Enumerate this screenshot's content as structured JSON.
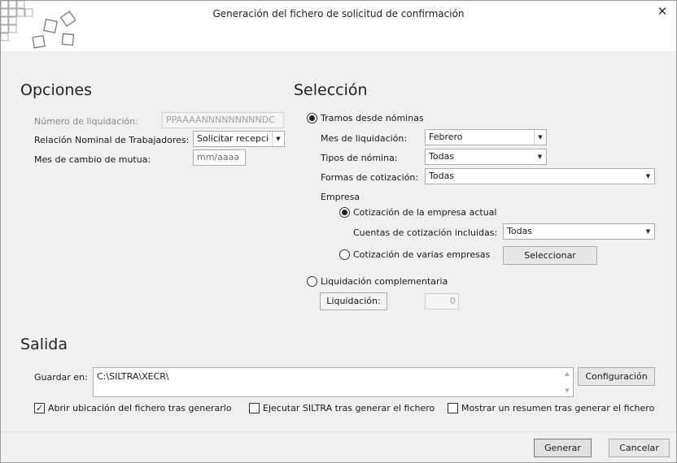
{
  "window": {
    "title": "Generación del fichero de solicitud de confirmación",
    "close_glyph": "✕"
  },
  "opciones": {
    "title": "Opciones",
    "numero_label": "Número de liquidación:",
    "numero_value": "PPAAAANNNNNNNNNDC",
    "relacion_label": "Relación Nominal de Trabajadores:",
    "relacion_value": "Solicitar recepció",
    "mes_cambio_label": "Mes de cambio de mutua:",
    "mes_cambio_placeholder": "mm/aaaa"
  },
  "seleccion": {
    "title": "Selección",
    "tramos_label": "Tramos desde nóminas",
    "tramos_selected": true,
    "mes_label": "Mes de liquidación:",
    "mes_value": "Febrero",
    "tipos_label": "Tipos de nómina:",
    "tipos_value": "Todas",
    "formas_label": "Formas de cotización:",
    "formas_value": "Todas",
    "empresa_label": "Empresa",
    "empresa_actual_label": "Cotización de la empresa actual",
    "empresa_actual_selected": true,
    "cuentas_label": "Cuentas de cotización incluidas:",
    "cuentas_value": "Todas",
    "varias_label": "Cotización de varias empresas",
    "varias_selected": false,
    "seleccionar_button": "Seleccionar",
    "complementaria_label": "Liquidación complementaria",
    "complementaria_selected": false,
    "liquidacion_button": "Liquidación:",
    "liquidacion_value": "0"
  },
  "salida": {
    "title": "Salida",
    "guardar_label": "Guardar en:",
    "guardar_value": "C:\\SILTRA\\XECR\\",
    "configuracion_button": "Configuración",
    "abrir_label": "Abrir ubicación del fichero tras generarlo",
    "abrir_checked": true,
    "ejecutar_label": "Ejecutar SILTRA tras generar el fichero",
    "ejecutar_checked": false,
    "mostrar_label": "Mostrar un resumen tras generar el fichero",
    "mostrar_checked": false
  },
  "footer": {
    "generar_button": "Generar",
    "cancelar_button": "Cancelar"
  },
  "icons": {
    "combo_arrow": "▼",
    "check_mark": "✓",
    "scroll_up": "▲",
    "scroll_down": "▼"
  }
}
